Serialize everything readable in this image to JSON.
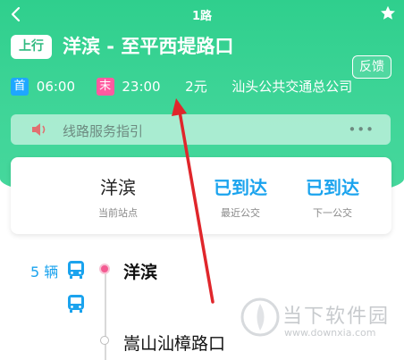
{
  "header": {
    "title": "1路",
    "direction_badge": "上行",
    "route_name": "洋滨 - 至平西堤路口",
    "feedback_label": "反馈"
  },
  "info": {
    "first_tag": "首",
    "first_time": "06:00",
    "last_tag": "末",
    "last_time": "23:00",
    "fare": "2元",
    "company": "汕头公共交通总公司"
  },
  "guide": {
    "label": "线路服务指引",
    "more": "•••"
  },
  "status_card": {
    "current_stop_name": "洋滨",
    "current_stop_caption": "当前站点",
    "nearest_bus_status": "已到达",
    "nearest_bus_caption": "最近公交",
    "next_bus_status": "已到达",
    "next_bus_caption": "下一公交"
  },
  "route_list": {
    "vehicle_count": "5 辆",
    "stops": [
      "洋滨",
      "嵩山汕樟路口"
    ]
  },
  "watermark": {
    "name": "当下软件园",
    "url": "www.downxia.com"
  },
  "colors": {
    "header_green": "#3fd598",
    "accent_blue": "#1aa3ee",
    "first_tag": "#1ea7ff",
    "last_tag": "#ff5aa0",
    "annotation_arrow": "#e0262b"
  }
}
